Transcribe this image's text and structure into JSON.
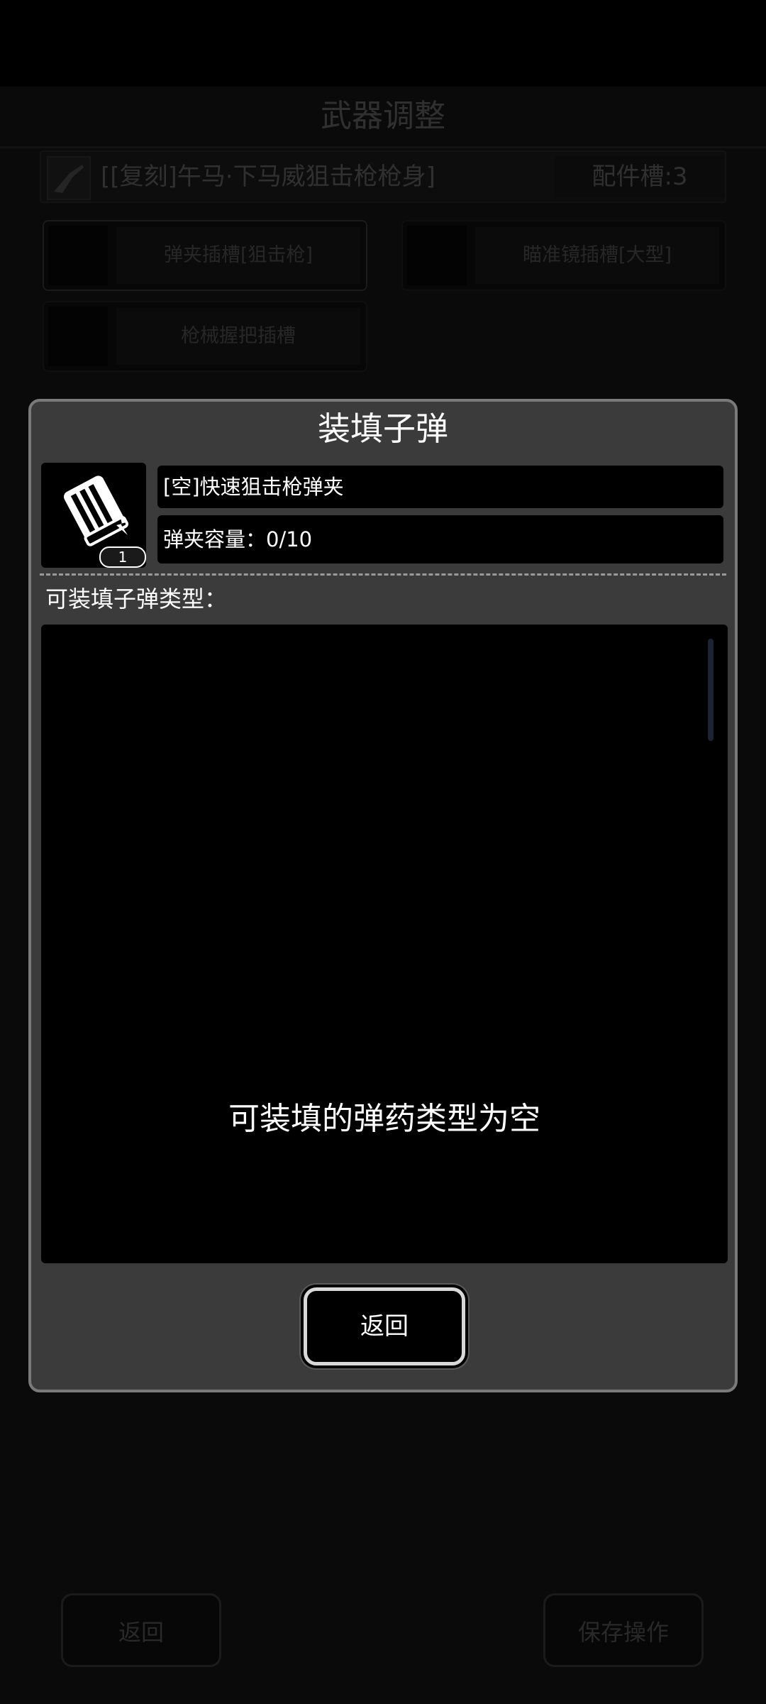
{
  "background": {
    "title": "武器调整",
    "weapon_name": "[[复刻]午马·下马威狙击枪枪身]",
    "slot_count": "配件槽:3",
    "slots": [
      {
        "label": "弹夹插槽[狙击枪]"
      },
      {
        "label": "瞄准镜插槽[大型]"
      },
      {
        "label": "枪械握把插槽"
      }
    ],
    "back_label": "返回",
    "save_label": "保存操作"
  },
  "modal": {
    "title": "装填子弹",
    "magazine": {
      "icon": "magazine-icon",
      "count": "1",
      "name": "[空]快速狙击枪弹夹",
      "capacity": "弹夹容量：0/10"
    },
    "ammo_section_label": "可装填子弹类型：",
    "empty_message": "可装填的弹药类型为空",
    "return_label": "返回"
  }
}
